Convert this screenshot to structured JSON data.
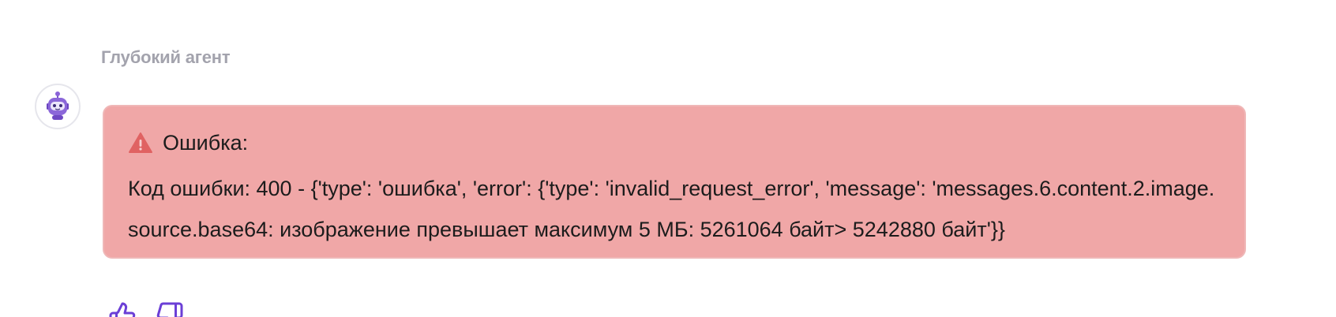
{
  "message": {
    "author": "Глубокий агент",
    "avatar_icon": "robot-icon",
    "error": {
      "title": "Ошибка:",
      "icon": "warning-icon",
      "text": "Код ошибки: 400 - {'type': 'ошибка', 'error': {'type': 'invalid_request_error', 'message': 'messages.6.content.2.image.source.base64: изображение превышает максимум 5 МБ: 5261064 байт> 5242880 байт'}}",
      "background_color": "#f0a7a7"
    },
    "feedback": {
      "like_icon": "thumbs-up-icon",
      "dislike_icon": "thumbs-down-icon",
      "accent_color": "#6b3fd6"
    }
  }
}
